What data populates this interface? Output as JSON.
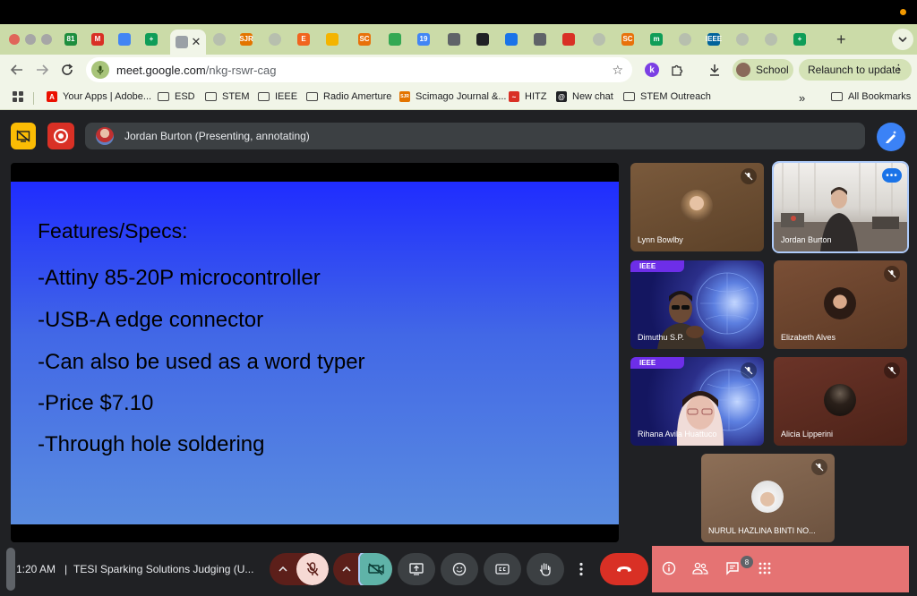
{
  "browser": {
    "url_host": "meet.google.com",
    "url_path": "/nkg-rswr-cag",
    "profile_name": "School",
    "relaunch_label": "Relaunch to update",
    "tabs": [
      {
        "icon": "gmail-count-icon",
        "label": "81",
        "color": "#1e8e3e"
      },
      {
        "icon": "gmail-icon",
        "label": "M",
        "color": "#d93025"
      },
      {
        "icon": "google-docs-icon",
        "label": "",
        "color": "#4285f4"
      },
      {
        "icon": "google-sheets-plus-icon",
        "label": "+",
        "color": "#0f9d58"
      },
      {
        "icon": "meet-active-icon",
        "label": "",
        "color": "#9aa0a6"
      },
      {
        "icon": "blank-icon",
        "label": "",
        "color": "#9aa0a6"
      },
      {
        "icon": "sjr-icon",
        "label": "SJR",
        "color": "#e37400"
      },
      {
        "icon": "blank-icon",
        "label": "",
        "color": "#9aa0a6"
      },
      {
        "icon": "etsy-icon",
        "label": "E",
        "color": "#f1641e"
      },
      {
        "icon": "slides-icon",
        "label": "",
        "color": "#f4b400"
      },
      {
        "icon": "sc-icon",
        "label": "SC",
        "color": "#e8710a"
      },
      {
        "icon": "drive-icon",
        "label": "",
        "color": "#34a853"
      },
      {
        "icon": "calendar-icon",
        "label": "19",
        "color": "#4285f4"
      },
      {
        "icon": "image-icon",
        "label": "",
        "color": "#5f6368"
      },
      {
        "icon": "openai-icon",
        "label": "",
        "color": "#202124"
      },
      {
        "icon": "gear-icon",
        "label": "",
        "color": "#1a73e8"
      },
      {
        "icon": "logo-tab-icon",
        "label": "",
        "color": "#5f6368"
      },
      {
        "icon": "hitz-icon",
        "label": "",
        "color": "#d93025"
      },
      {
        "icon": "blank-icon",
        "label": "",
        "color": "#9aa0a6"
      },
      {
        "icon": "sc-icon",
        "label": "SC",
        "color": "#e8710a"
      },
      {
        "icon": "m-icon",
        "label": "m",
        "color": "#0f9d58"
      },
      {
        "icon": "blank-icon",
        "label": "",
        "color": "#9aa0a6"
      },
      {
        "icon": "ieee-icon",
        "label": "IEEE",
        "color": "#00629b"
      },
      {
        "icon": "blank-icon",
        "label": "",
        "color": "#9aa0a6"
      },
      {
        "icon": "blank-icon",
        "label": "",
        "color": "#9aa0a6"
      },
      {
        "icon": "google-sheets-plus-icon",
        "label": "+",
        "color": "#0f9d58"
      }
    ],
    "bookmarks": [
      {
        "label": "Your Apps | Adobe...",
        "type": "adobe"
      },
      {
        "label": "ESD",
        "type": "folder"
      },
      {
        "label": "STEM",
        "type": "folder"
      },
      {
        "label": "IEEE",
        "type": "folder"
      },
      {
        "label": "Radio Amerture",
        "type": "folder"
      },
      {
        "label": "Scimago Journal &...",
        "type": "sjr"
      },
      {
        "label": "HITZ",
        "type": "hitz"
      },
      {
        "label": "New chat",
        "type": "openai"
      },
      {
        "label": "STEM Outreach",
        "type": "folder"
      }
    ],
    "all_bookmarks_label": "All Bookmarks",
    "overflow_label": "»"
  },
  "meet": {
    "presenter_label": "Jordan Burton (Presenting, annotating)",
    "slide": {
      "title": "Features/Specs:",
      "lines": [
        "-Attiny 85-20P microcontroller",
        "-USB-A edge connector",
        "-Can also be used as a word typer",
        "-Price $7.10",
        "-Through hole soldering"
      ]
    },
    "participants": [
      {
        "name": "Lynn Bowlby",
        "muted": true
      },
      {
        "name": "Jordan Burton",
        "muted": false
      },
      {
        "name": "Dimuthu S.P.",
        "muted": false,
        "badge": "IEEE"
      },
      {
        "name": "Elizabeth Alves",
        "muted": true
      },
      {
        "name": "Rihana Avila Huattuco",
        "muted": true,
        "badge": "IEEE"
      },
      {
        "name": "Alicia Lipperini",
        "muted": true
      },
      {
        "name": "NURUL HAZLINA BINTI NO...",
        "muted": true
      }
    ],
    "controls": {
      "time": "1:20 AM",
      "separator": "|",
      "meeting_title": "TESI Sparking Solutions Judging (U...",
      "people_count": "8"
    },
    "colors": {
      "accent_blue": "#1a73e8",
      "leave_red": "#d93025",
      "tab_strip": "#cbdba8"
    }
  }
}
